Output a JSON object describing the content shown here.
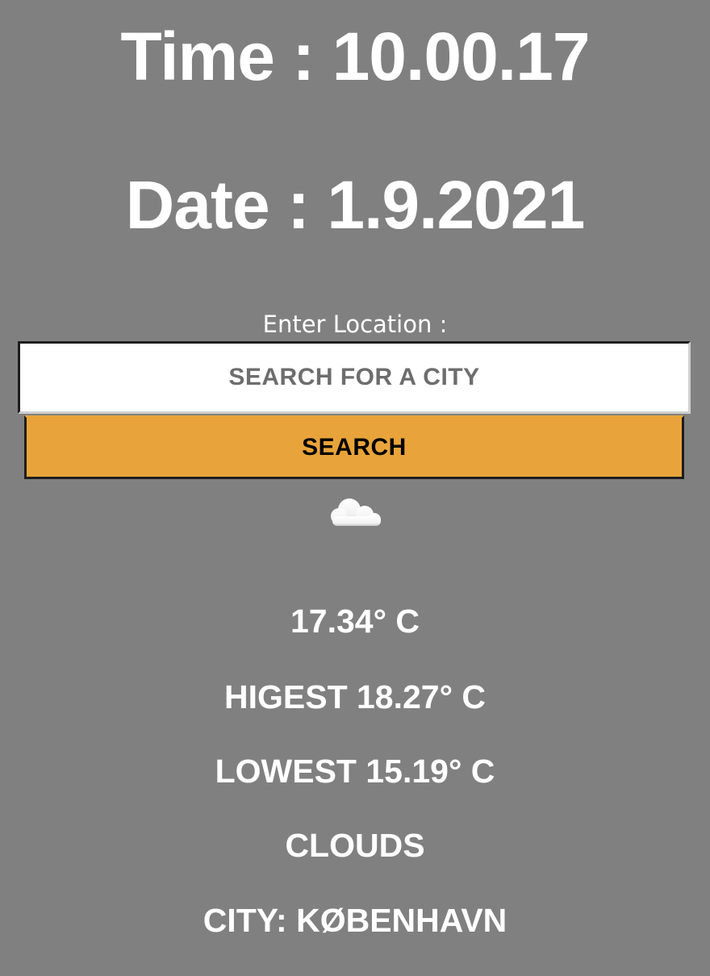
{
  "clock": {
    "time_text": "Time : 10.00.17",
    "date_text": "Date : 1.9.2021"
  },
  "search": {
    "label": "Enter Location :",
    "placeholder": "SEARCH FOR A CITY",
    "button_label": "SEARCH"
  },
  "weather": {
    "icon": "cloud-icon",
    "temperature": "17.34° C",
    "highest": "HIGEST 18.27° C",
    "lowest": "LOWEST 15.19° C",
    "condition": "CLOUDS",
    "city": "CITY: KØBENHAVN"
  },
  "colors": {
    "background": "#808080",
    "text": "#ffffff",
    "button": "#e8a43a"
  }
}
